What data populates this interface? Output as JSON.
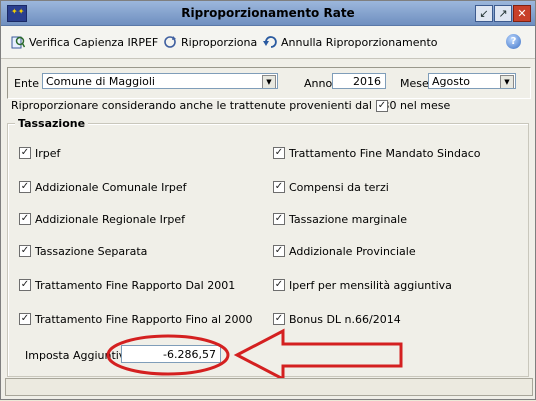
{
  "window": {
    "title": "Riproporzionamento Rate",
    "buttons": {
      "minimize": "↙",
      "maximize": "↗",
      "close": "✕"
    }
  },
  "toolbar": {
    "verifica": "Verifica Capienza IRPEF",
    "riproporziona": "Riproporziona",
    "annulla": "Annulla Riproporzionamento",
    "help": "?"
  },
  "params": {
    "ente_label": "Ente",
    "ente_value": "Comune di Maggioli",
    "anno_label": "Anno",
    "anno_value": "2016",
    "mese_label": "Mese",
    "mese_value": "Agosto"
  },
  "option730": {
    "label": "Riproporzionare considerando anche le trattenute provenienti dal 730 nel mese",
    "checked": true
  },
  "tassazione": {
    "title": "Tassazione",
    "left": [
      {
        "label": "Irpef",
        "checked": true
      },
      {
        "label": "Addizionale Comunale Irpef",
        "checked": true
      },
      {
        "label": "Addizionale Regionale Irpef",
        "checked": true
      },
      {
        "label": "Tassazione Separata",
        "checked": true
      },
      {
        "label": "Trattamento Fine Rapporto Dal 2001",
        "checked": true
      },
      {
        "label": "Trattamento Fine Rapporto Fino al 2000",
        "checked": true
      }
    ],
    "right": [
      {
        "label": "Trattamento Fine Mandato Sindaco",
        "checked": true
      },
      {
        "label": "Compensi da terzi",
        "checked": true
      },
      {
        "label": "Tassazione marginale",
        "checked": true
      },
      {
        "label": "Addizionale Provinciale",
        "checked": true
      },
      {
        "label": "Iperf per mensilità aggiuntiva",
        "checked": true
      },
      {
        "label": "Bonus DL n.66/2014",
        "checked": true
      }
    ],
    "imposta_label": "Imposta Aggiuntiva",
    "imposta_value": "-6.286,57"
  },
  "colors": {
    "annotation": "#d42020",
    "title_bar": "#8aa8d6"
  }
}
